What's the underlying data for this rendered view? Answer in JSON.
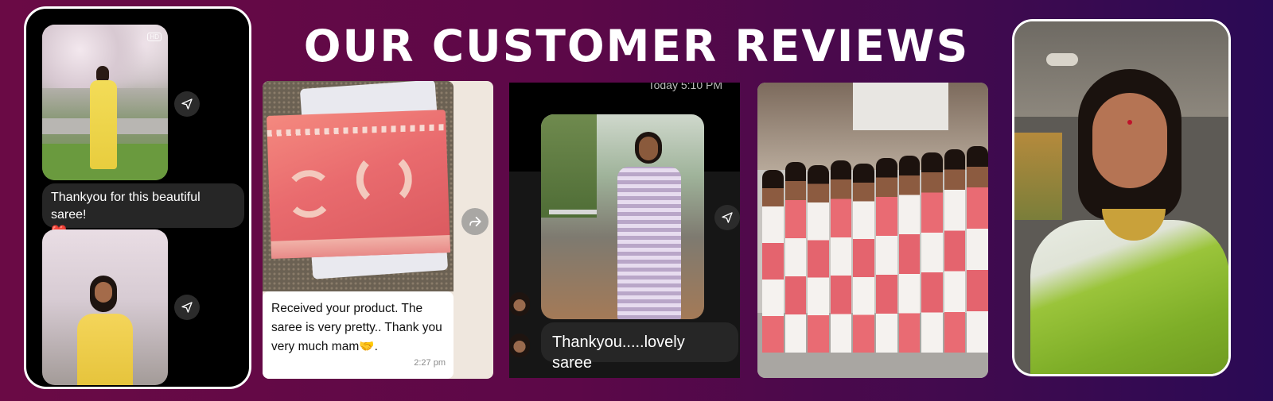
{
  "page": {
    "heading": "OUR CUSTOMER REVIEWS"
  },
  "review_instagram": {
    "badge": "HD",
    "message": "Thankyou for this beautiful saree!",
    "emoji": "❤️"
  },
  "review_whatsapp": {
    "message": "Received your product. The saree is very pretty.. Thank you very much mam",
    "emoji": "🤝",
    "period": ".",
    "time": "2:27 pm"
  },
  "review_chat": {
    "timestamp": "Today 5:10 PM",
    "message": "Thankyou.....lovely saree"
  },
  "colors": {
    "background": "#5c0848",
    "accent_saree": "#e96b73",
    "chat_bubble": "#262626"
  },
  "icons": [
    "send-icon",
    "forward-icon",
    "avatar"
  ]
}
